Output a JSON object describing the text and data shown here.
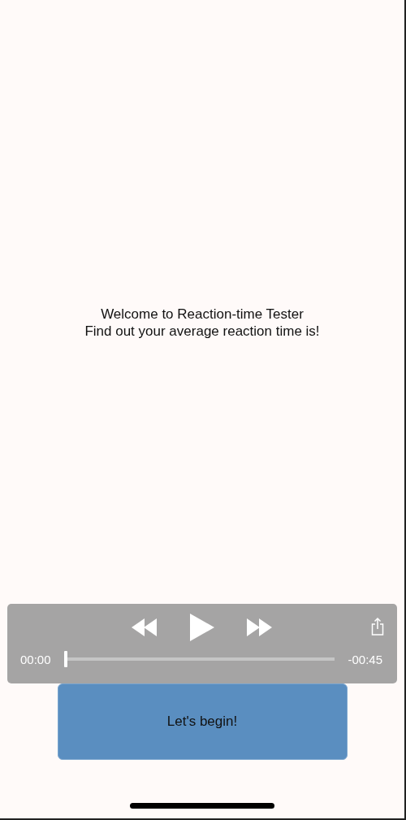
{
  "welcome": {
    "title": "Welcome to Reaction-time Tester",
    "subtitle": "Find out your average reaction time is!"
  },
  "player": {
    "elapsed": "00:00",
    "remaining": "-00:45",
    "progress": {
      "level": 0
    }
  },
  "start_button": {
    "label": "Let's begin!"
  }
}
